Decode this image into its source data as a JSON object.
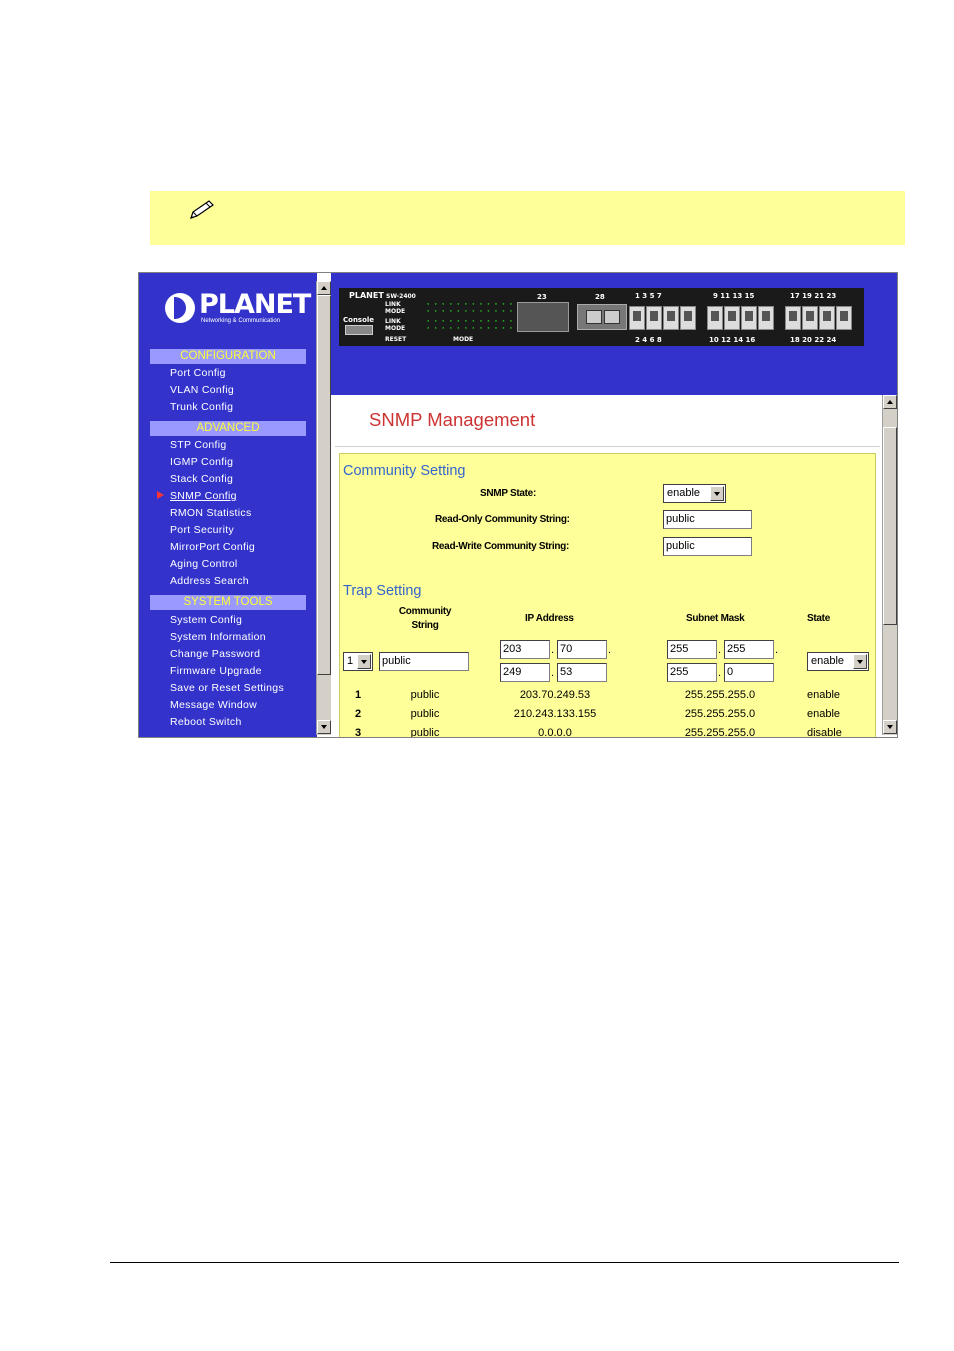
{
  "nav": {
    "logo_text": "PLANET",
    "logo_sub": "Networking & Communication",
    "sections": [
      {
        "title": "CONFIGURATION",
        "items": [
          "Port Config",
          "VLAN Config",
          "Trunk Config"
        ]
      },
      {
        "title": "ADVANCED",
        "items": [
          "STP Config",
          "IGMP Config",
          "Stack Config",
          "SNMP Config",
          "RMON Statistics",
          "Port Security",
          "MirrorPort Config",
          "Aging Control",
          "Address Search"
        ]
      },
      {
        "title": "SYSTEM TOOLS",
        "items": [
          "System Config",
          "System Information",
          "Change Password",
          "Firmware Upgrade",
          "Save or Reset Settings",
          "Message Window",
          "Reboot Switch"
        ]
      }
    ],
    "active_item": "SNMP Config"
  },
  "switch_panel": {
    "brand": "PLANET",
    "console": "Console",
    "model": "SW-2400",
    "reset": "RESET",
    "mode": "MODE",
    "row_labels": [
      "LINK",
      "MODE",
      "LINK",
      "MODE"
    ],
    "top_nums": "1 3 5 7  9 11 13 15  17 19 21 23",
    "bottom_nums": "2 4 6 8  10 12 14 16  18 20 22 24",
    "port_23": "23",
    "port_28": "28",
    "grp1_top": "1   3   5   7",
    "grp2_top": "9   11   13  15",
    "grp3_top": "17  19   21  23",
    "grp1_bot": "2   4   6   8",
    "grp2_bot": "10  12   14  16",
    "grp3_bot": "18  20   22  24"
  },
  "page": {
    "title": "SNMP Management"
  },
  "community": {
    "header": "Community Setting",
    "snmp_state_label": "SNMP State:",
    "snmp_state_value": "enable",
    "ro_label": "Read-Only Community String:",
    "ro_value": "public",
    "rw_label": "Read-Write Community String:",
    "rw_value": "public"
  },
  "trap": {
    "header": "Trap Setting",
    "col_community_1": "Community",
    "col_community_2": "String",
    "col_ip": "IP Address",
    "col_mask": "Subnet Mask",
    "col_state": "State",
    "index_value": "1",
    "community_value": "public",
    "ip": [
      "203",
      "70",
      "249",
      "53"
    ],
    "mask": [
      "255",
      "255",
      "255",
      "0"
    ],
    "state_value": "enable",
    "rows": [
      {
        "idx": "1",
        "community": "public",
        "ip": "203.70.249.53",
        "mask": "255.255.255.0",
        "state": "enable"
      },
      {
        "idx": "2",
        "community": "public",
        "ip": "210.243.133.155",
        "mask": "255.255.255.0",
        "state": "enable"
      },
      {
        "idx": "3",
        "community": "public",
        "ip": "0.0.0.0",
        "mask": "255.255.255.0",
        "state": "disable"
      }
    ]
  },
  "colors": {
    "nav_bg": "#3333cc",
    "section_bg": "#9999ff",
    "section_text": "#ffff33",
    "title_red": "#cc3333",
    "panel_yellow": "#ffff99",
    "header_blue": "#3366cc"
  }
}
